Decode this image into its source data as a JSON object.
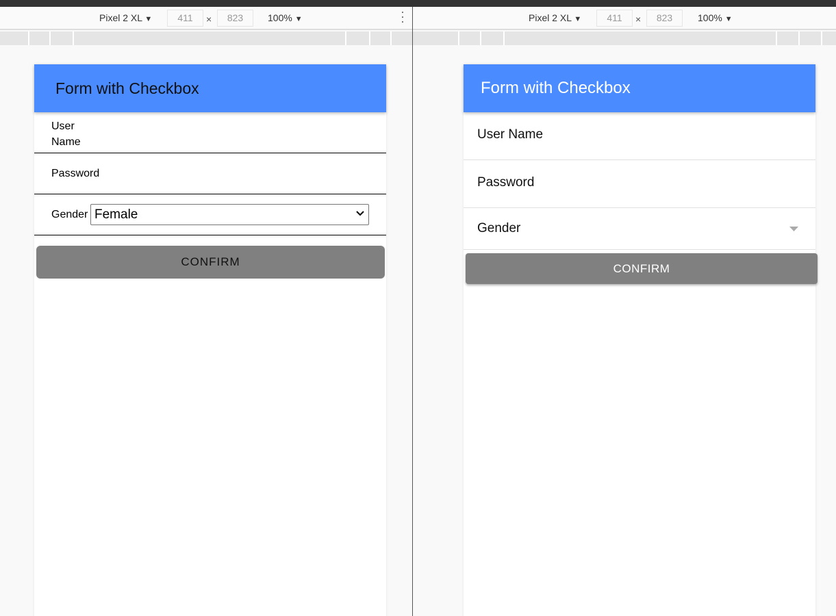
{
  "devtools": {
    "device": "Pixel 2 XL",
    "width": "411",
    "height": "823",
    "times": "×",
    "zoom": "100%",
    "arrow": "▼"
  },
  "left": {
    "title": "Form with Checkbox",
    "username_line1": "User",
    "username_line2": "Name",
    "password": "Password",
    "gender": "Gender",
    "gender_value": "Female",
    "confirm": "CONFIRM"
  },
  "right": {
    "title": "Form with Checkbox",
    "username": "User Name",
    "password": "Password",
    "gender": "Gender",
    "confirm": "CONFIRM"
  },
  "colors": {
    "header": "#4a8cff",
    "button": "#808080"
  }
}
